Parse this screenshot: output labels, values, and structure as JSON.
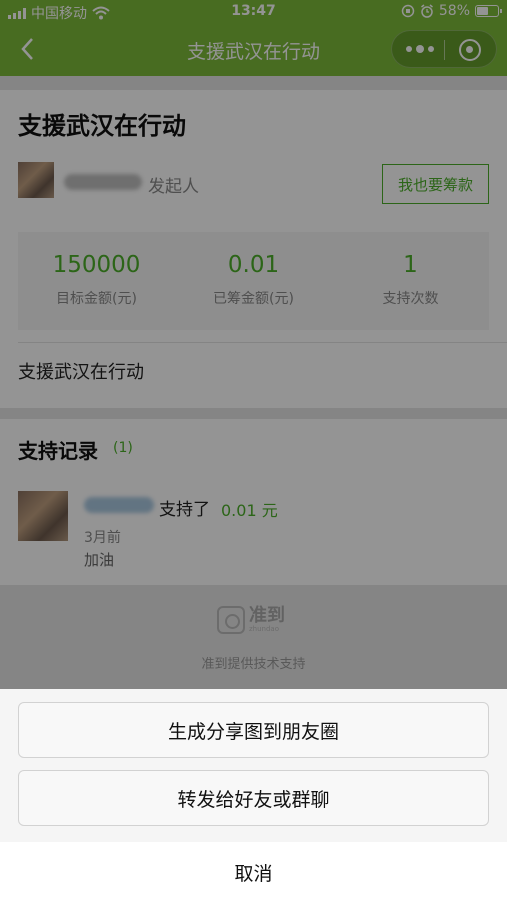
{
  "status_bar": {
    "carrier": "中国移动",
    "time": "13:47",
    "battery": "58%",
    "battery_level": 0.58
  },
  "nav": {
    "title": "支援武汉在行动"
  },
  "project": {
    "title": "支援武汉在行动",
    "initiator_label": "发起人",
    "raise_button": "我也要筹款",
    "stats": [
      {
        "value": "150000",
        "label": "目标金额(元)"
      },
      {
        "value": "0.01",
        "label": "已筹金额(元)"
      },
      {
        "value": "1",
        "label": "支持次数"
      }
    ],
    "description": "支援武汉在行动"
  },
  "records": {
    "title": "支持记录",
    "count": "(1)",
    "items": [
      {
        "action": "支持了",
        "amount": "0.01 元",
        "time": "3月前",
        "message": "加油"
      }
    ]
  },
  "footer": {
    "logo_text": "准到",
    "logo_sub": "zhundao",
    "powered_by": "准到提供技术支持"
  },
  "sheet": {
    "share_moments": "生成分享图到朋友圈",
    "forward": "转发给好友或群聊",
    "cancel": "取消"
  }
}
